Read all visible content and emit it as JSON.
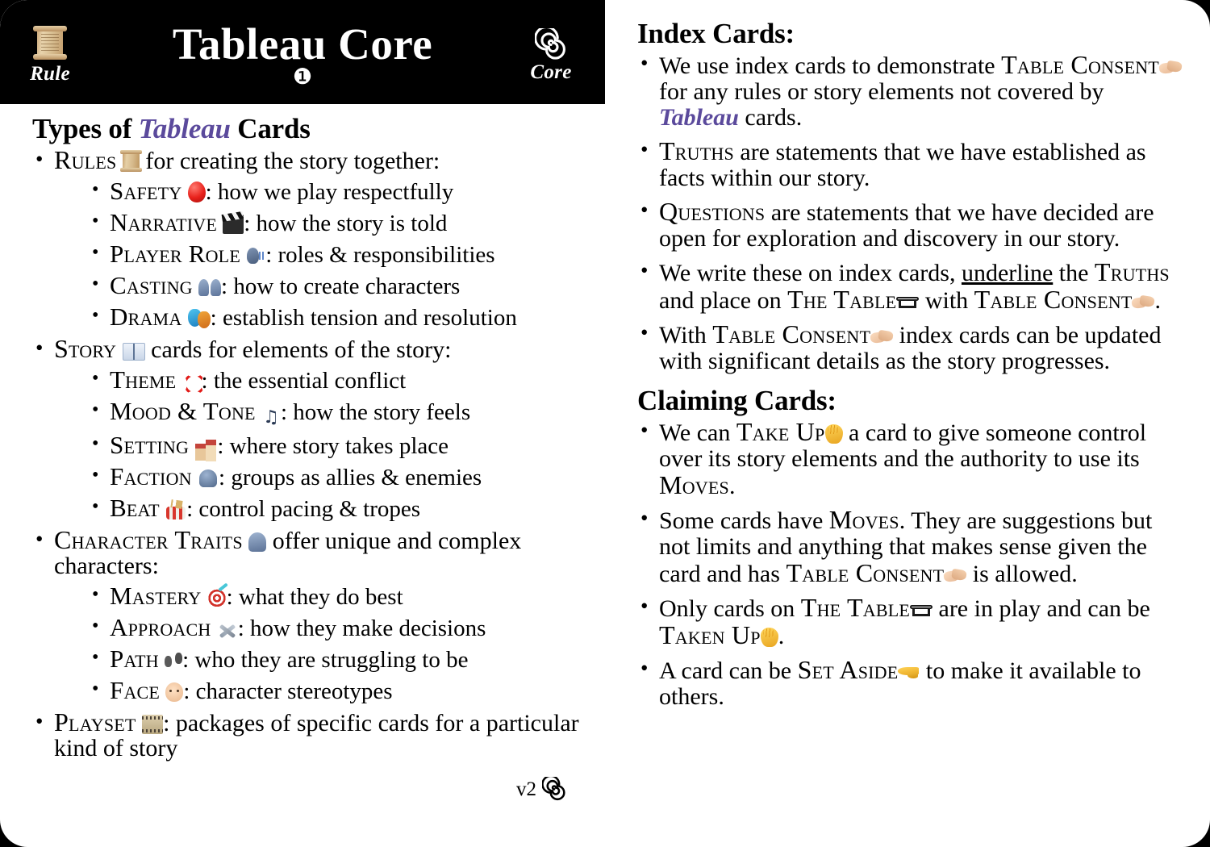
{
  "card": {
    "background_color": "#ffffff",
    "header_color": "#000000",
    "accent_color": "#5b4a9c"
  },
  "header": {
    "title": "Tableau Core",
    "number_badge": "❶",
    "left_icon_label": "Rule",
    "left_icon_name": "scroll-icon",
    "right_icon_label": "Core",
    "right_icon_name": "spiral-icon"
  },
  "left_column": {
    "heading_pre": "Types of ",
    "heading_brand": "Tableau",
    "heading_post": " Cards",
    "groups": [
      {
        "lead_term": "Rules",
        "lead_icon": "scroll-icon",
        "lead_rest": " for creating the story together:",
        "children": [
          {
            "term": "Safety",
            "icon": "red-balloon-icon",
            "rest": ": how we play respectfully"
          },
          {
            "term": "Narrative",
            "icon": "clapper-board-icon",
            "rest": ": how the story is told"
          },
          {
            "term": "Player Role",
            "icon": "speaking-head-icon",
            "rest": ": roles & responsibilities"
          },
          {
            "term": "Casting",
            "icon": "two-busts-icon",
            "rest": ": how to create characters"
          },
          {
            "term": "Drama",
            "icon": "theater-masks-icon",
            "rest": ": establish tension and resolution"
          }
        ]
      },
      {
        "lead_term": "Story",
        "lead_icon": "open-book-icon",
        "lead_rest": " cards for elements of the story:",
        "children": [
          {
            "term": "Theme",
            "icon": "anger-symbol-icon",
            "rest": ": the essential conflict"
          },
          {
            "term": "Mood & Tone",
            "icon": "musical-notes-icon",
            "rest": ": how the story feels"
          },
          {
            "term": "Setting",
            "icon": "houses-icon",
            "rest": ": where story takes place"
          },
          {
            "term": "Faction",
            "icon": "silhouette-group-icon",
            "rest": ": groups as allies & enemies"
          },
          {
            "term": "Beat",
            "icon": "drum-icon",
            "rest": ": control pacing & tropes"
          }
        ]
      },
      {
        "lead_term": "Character Traits",
        "lead_icon": "bust-silhouette-icon",
        "lead_rest": " offer unique and complex characters:",
        "children": [
          {
            "term": "Mastery",
            "icon": "dart-target-icon",
            "rest": ": what they do best"
          },
          {
            "term": "Approach",
            "icon": "hammer-wrench-icon",
            "rest": ": how they make decisions"
          },
          {
            "term": "Path",
            "icon": "footprints-icon",
            "rest": ": who they are struggling to be"
          },
          {
            "term": "Face",
            "icon": "face-icon",
            "rest": ": character stereotypes"
          }
        ]
      },
      {
        "lead_term": "Playset",
        "lead_icon": "film-frames-icon",
        "lead_rest": ": packages of specific cards for a particular kind of story",
        "children": []
      }
    ],
    "version_label": "v2",
    "version_icon": "spiral-icon"
  },
  "right_column": {
    "sections": [
      {
        "heading": "Index Cards:",
        "bullets": [
          {
            "parts": [
              {
                "t": "text",
                "v": "We use index cards to demonstrate "
              },
              {
                "t": "sc",
                "v": "Table Consent"
              },
              {
                "t": "icon",
                "v": "handshake-icon"
              },
              {
                "t": "text",
                "v": " for any rules or story elements not covered by "
              },
              {
                "t": "brand",
                "v": "Tableau"
              },
              {
                "t": "text",
                "v": " cards."
              }
            ]
          },
          {
            "parts": [
              {
                "t": "sc",
                "v": "Truths"
              },
              {
                "t": "text",
                "v": " are statements that we have established as facts within our story."
              }
            ]
          },
          {
            "parts": [
              {
                "t": "sc",
                "v": "Questions"
              },
              {
                "t": "text",
                "v": " are statements that we have decided are open for exploration and discovery in our story."
              }
            ]
          },
          {
            "parts": [
              {
                "t": "text",
                "v": "We write these on index cards, "
              },
              {
                "t": "u",
                "v": "underline"
              },
              {
                "t": "text",
                "v": " the "
              },
              {
                "t": "sc",
                "v": "Truths"
              },
              {
                "t": "text",
                "v": " and place on "
              },
              {
                "t": "sc",
                "v": "The Table"
              },
              {
                "t": "icon",
                "v": "table-icon"
              },
              {
                "t": "text",
                "v": " with "
              },
              {
                "t": "sc",
                "v": "Table Consent"
              },
              {
                "t": "icon",
                "v": "handshake-icon"
              },
              {
                "t": "text",
                "v": "."
              }
            ]
          },
          {
            "parts": [
              {
                "t": "text",
                "v": "With "
              },
              {
                "t": "sc",
                "v": "Table Consent"
              },
              {
                "t": "icon",
                "v": "handshake-icon"
              },
              {
                "t": "text",
                "v": " index cards can be updated with significant details as the story progresses."
              }
            ]
          }
        ]
      },
      {
        "heading": "Claiming Cards:",
        "bullets": [
          {
            "parts": [
              {
                "t": "text",
                "v": "We can "
              },
              {
                "t": "sc",
                "v": "Take Up"
              },
              {
                "t": "icon",
                "v": "raised-hand-icon"
              },
              {
                "t": "text",
                "v": " a card to give someone control over its story elements and the authority to use its "
              },
              {
                "t": "sc",
                "v": "Moves"
              },
              {
                "t": "text",
                "v": "."
              }
            ]
          },
          {
            "parts": [
              {
                "t": "text",
                "v": "Some cards have "
              },
              {
                "t": "sc",
                "v": "Moves"
              },
              {
                "t": "text",
                "v": ". They are suggestions but not limits and anything that makes sense given the card and has "
              },
              {
                "t": "sc",
                "v": "Table Consent"
              },
              {
                "t": "icon",
                "v": "handshake-icon"
              },
              {
                "t": "text",
                "v": " is allowed."
              }
            ]
          },
          {
            "parts": [
              {
                "t": "text",
                "v": "Only cards on "
              },
              {
                "t": "sc",
                "v": "The Table"
              },
              {
                "t": "icon",
                "v": "table-icon"
              },
              {
                "t": "text",
                "v": " are in play and can be "
              },
              {
                "t": "sc",
                "v": "Taken Up"
              },
              {
                "t": "icon",
                "v": "raised-hand-icon"
              },
              {
                "t": "text",
                "v": "."
              }
            ]
          },
          {
            "parts": [
              {
                "t": "text",
                "v": "A card can be "
              },
              {
                "t": "sc",
                "v": "Set Aside"
              },
              {
                "t": "icon",
                "v": "pointing-hand-icon"
              },
              {
                "t": "text",
                "v": " to make it available to others."
              }
            ]
          }
        ]
      }
    ]
  }
}
